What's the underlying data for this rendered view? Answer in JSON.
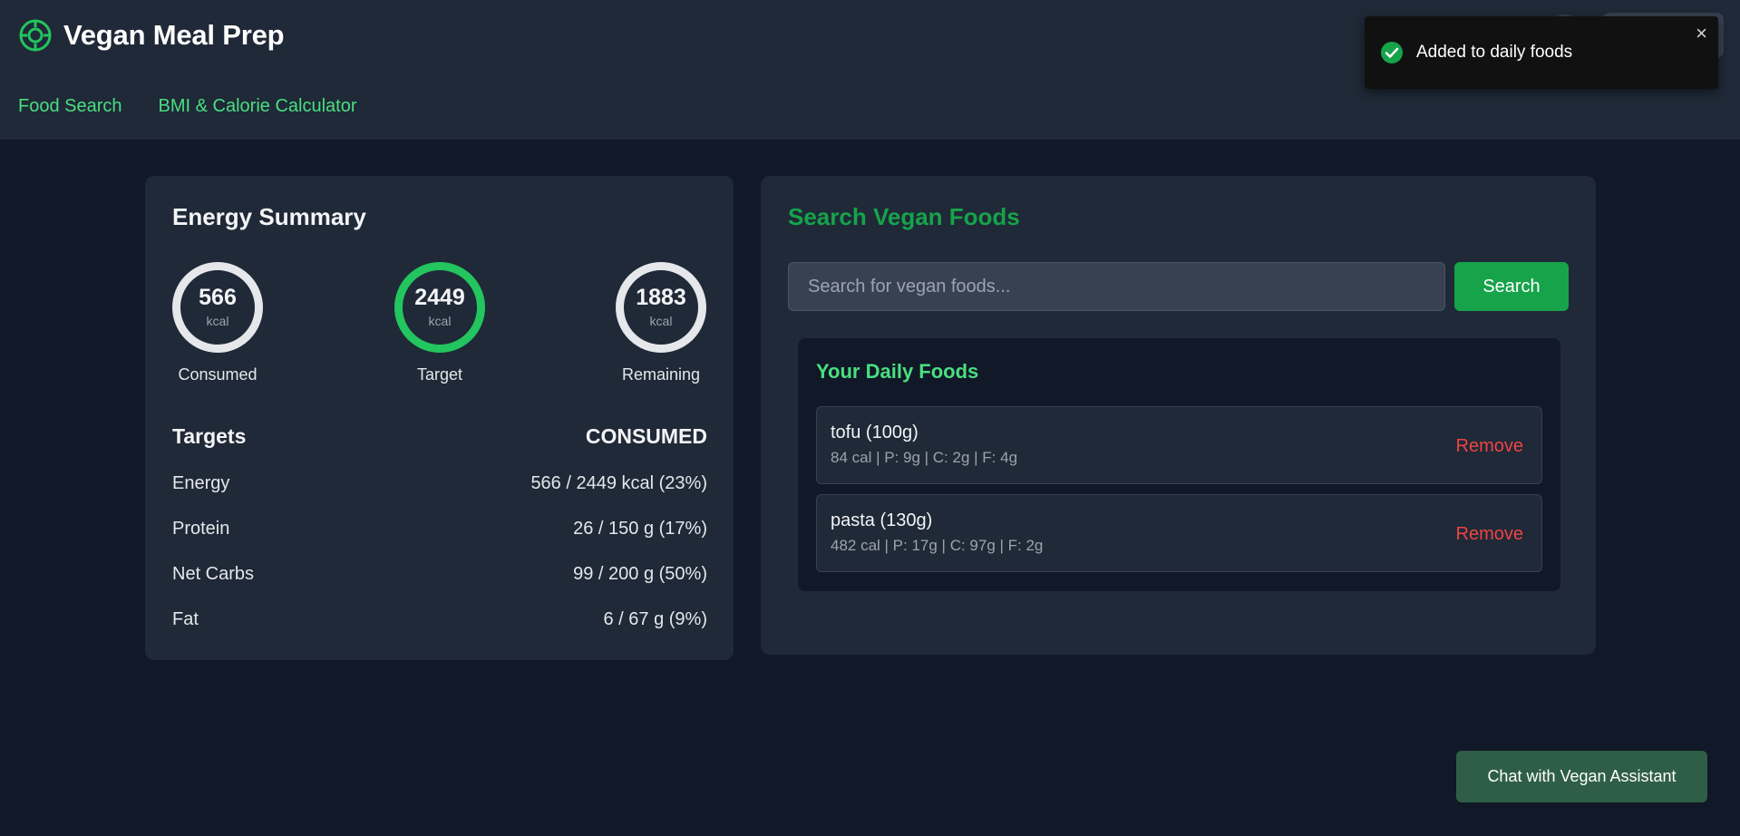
{
  "app": {
    "title": "Vegan Meal Prep",
    "accent_color": "#22c55e"
  },
  "nav": {
    "items": [
      {
        "label": "Food Search"
      },
      {
        "label": "BMI & Calorie Calculator"
      }
    ]
  },
  "toast": {
    "message": "Added to daily foods",
    "close_icon": "×",
    "status_color": "#16a34a"
  },
  "energy_summary": {
    "title": "Energy Summary",
    "rings": [
      {
        "value": "566",
        "unit": "kcal",
        "label": "Consumed"
      },
      {
        "value": "2449",
        "unit": "kcal",
        "label": "Target"
      },
      {
        "value": "1883",
        "unit": "kcal",
        "label": "Remaining"
      }
    ],
    "targets_heading": "Targets",
    "consumed_heading": "CONSUMED",
    "targets": [
      {
        "name": "Energy",
        "value": "566 / 2449 kcal (23%)"
      },
      {
        "name": "Protein",
        "value": "26 / 150 g (17%)"
      },
      {
        "name": "Net Carbs",
        "value": "99 / 200 g (50%)"
      },
      {
        "name": "Fat",
        "value": "6 / 67 g (9%)"
      }
    ]
  },
  "search": {
    "title": "Search Vegan Foods",
    "placeholder": "Search for vegan foods...",
    "value": "",
    "button_label": "Search"
  },
  "daily_foods": {
    "title": "Your Daily Foods",
    "items": [
      {
        "name": "tofu (100g)",
        "macros": "84 cal | P: 9g | C: 2g | F: 4g",
        "remove_label": "Remove"
      },
      {
        "name": "pasta (130g)",
        "macros": "482 cal | P: 17g | C: 97g | F: 2g",
        "remove_label": "Remove"
      }
    ]
  },
  "chat": {
    "button_label": "Chat with Vegan Assistant"
  }
}
